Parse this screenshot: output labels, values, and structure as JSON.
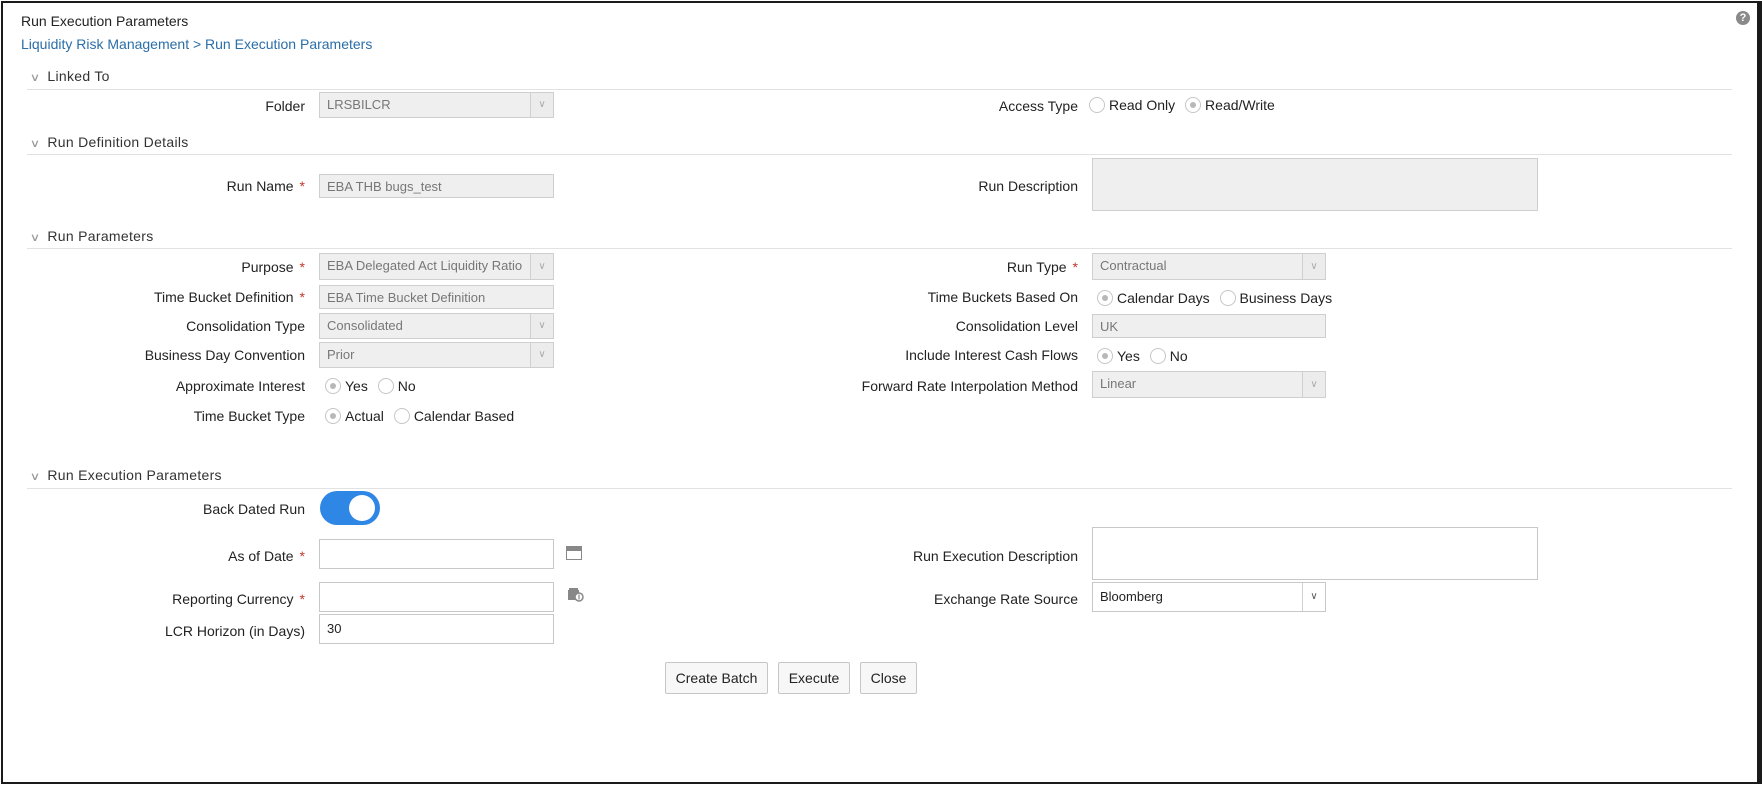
{
  "header": {
    "title": "Run Execution Parameters",
    "breadcrumb": "Liquidity Risk Management > Run Execution Parameters",
    "help_icon": "?"
  },
  "sections": {
    "linked_to": "Linked To",
    "run_definition": "Run Definition Details",
    "run_parameters": "Run Parameters",
    "run_execution": "Run Execution Parameters"
  },
  "linked_to": {
    "folder_label": "Folder",
    "folder_value": "LRSBILCR",
    "access_type_label": "Access Type",
    "access_options": [
      "Read Only",
      "Read/Write"
    ],
    "access_selected": "Read/Write"
  },
  "run_definition": {
    "run_name_label": "Run Name",
    "run_name_value": "EBA THB bugs_test",
    "run_description_label": "Run Description",
    "run_description_value": ""
  },
  "run_parameters": {
    "purpose_label": "Purpose",
    "purpose_value": "EBA Delegated Act Liquidity Ratio",
    "time_bucket_def_label": "Time Bucket Definition",
    "time_bucket_def_value": "EBA Time Bucket Definition",
    "consolidation_type_label": "Consolidation Type",
    "consolidation_type_value": "Consolidated",
    "business_day_label": "Business Day Convention",
    "business_day_value": "Prior",
    "approx_interest_label": "Approximate Interest",
    "approx_interest_options": [
      "Yes",
      "No"
    ],
    "approx_interest_selected": "Yes",
    "time_bucket_type_label": "Time Bucket Type",
    "time_bucket_type_options": [
      "Actual",
      "Calendar Based"
    ],
    "time_bucket_type_selected": "Actual",
    "run_type_label": "Run Type",
    "run_type_value": "Contractual",
    "tb_based_on_label": "Time Buckets Based On",
    "tb_based_on_options": [
      "Calendar Days",
      "Business Days"
    ],
    "tb_based_on_selected": "Calendar Days",
    "consolidation_level_label": "Consolidation Level",
    "consolidation_level_value": "UK",
    "include_interest_label": "Include Interest Cash Flows",
    "include_interest_options": [
      "Yes",
      "No"
    ],
    "include_interest_selected": "Yes",
    "forward_rate_label": "Forward Rate Interpolation Method",
    "forward_rate_value": "Linear"
  },
  "run_execution": {
    "back_dated_label": "Back Dated Run",
    "back_dated_on": true,
    "as_of_date_label": "As of Date",
    "as_of_date_value": "",
    "reporting_currency_label": "Reporting Currency",
    "reporting_currency_value": "",
    "lcr_horizon_label": "LCR Horizon (in Days)",
    "lcr_horizon_value": "30",
    "run_exec_desc_label": "Run Execution Description",
    "run_exec_desc_value": "",
    "exchange_rate_label": "Exchange Rate Source",
    "exchange_rate_value": "Bloomberg"
  },
  "required_mark": "*",
  "buttons": {
    "create_batch": "Create Batch",
    "execute": "Execute",
    "close": "Close"
  },
  "colors": {
    "link": "#2a6ea8",
    "toggle_on": "#2e87e4",
    "required": "#c0392b"
  }
}
